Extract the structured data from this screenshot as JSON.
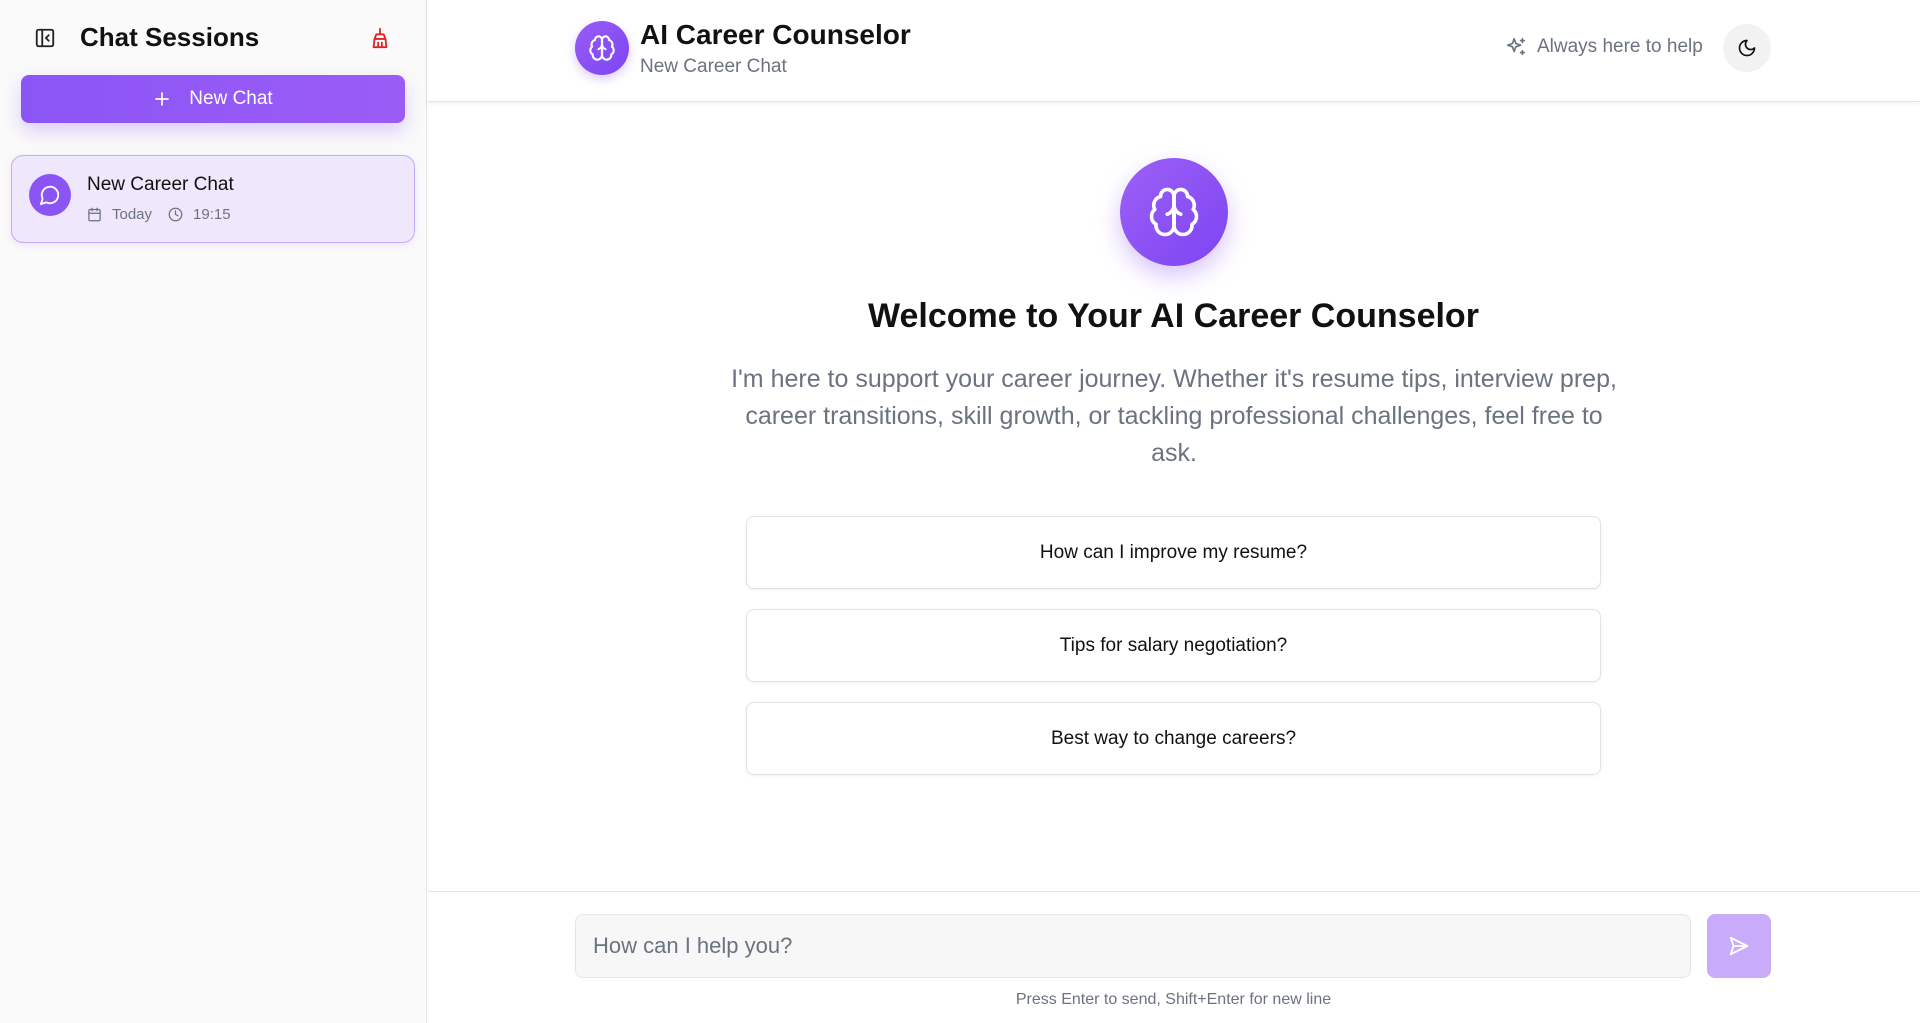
{
  "sidebar": {
    "title": "Chat Sessions",
    "new_chat_label": "New Chat",
    "sessions": [
      {
        "title": "New Career Chat",
        "date": "Today",
        "time": "19:15",
        "active": true
      }
    ]
  },
  "header": {
    "title": "AI Career Counselor",
    "subtitle": "New Career Chat",
    "help_text": "Always here to help"
  },
  "welcome": {
    "title": "Welcome to Your AI Career Counselor",
    "text": "I'm here to support your career journey. Whether it's resume tips, interview prep, career transitions, skill growth, or tackling professional challenges, feel free to ask.",
    "suggestions": [
      "How can I improve my resume?",
      "Tips for salary negotiation?",
      "Best way to change careers?"
    ]
  },
  "composer": {
    "placeholder": "How can I help you?",
    "value": "",
    "hint": "Press Enter to send, Shift+Enter for new line"
  },
  "colors": {
    "accent": "#8b55f6",
    "accent_light": "#efe7fb",
    "send_disabled": "#c9acf9",
    "danger": "#dc2626"
  },
  "icons": {
    "sidebar_toggle": "panel-left-close-icon",
    "clear": "brush-icon",
    "new_chat": "plus-icon",
    "session": "message-circle-icon",
    "date": "calendar-icon",
    "time": "clock-icon",
    "brand": "brain-icon",
    "help": "sparkles-icon",
    "theme": "moon-icon",
    "send": "send-icon"
  }
}
